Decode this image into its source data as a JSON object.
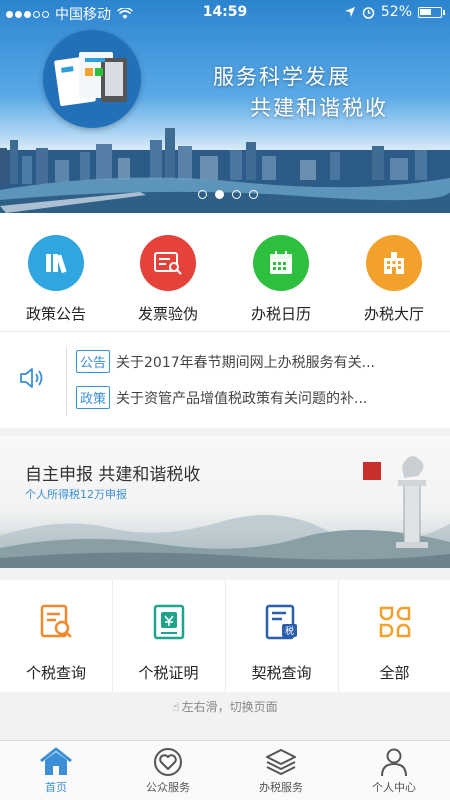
{
  "status_bar": {
    "carrier": "中国移动",
    "time": "14:59",
    "battery": "52%"
  },
  "banner": {
    "line1": "服务科学发展",
    "line2": "共建和谐税收",
    "active_page": 2,
    "page_count": 4
  },
  "quick_actions": [
    {
      "label": "政策公告",
      "icon": "policy-books-icon",
      "color": "#2fa6df"
    },
    {
      "label": "发票验伪",
      "icon": "invoice-search-icon",
      "color": "#e4423b"
    },
    {
      "label": "办税日历",
      "icon": "calendar-icon",
      "color": "#2fbf3f"
    },
    {
      "label": "办税大厅",
      "icon": "tax-hall-building-icon",
      "color": "#f2a12a"
    }
  ],
  "news": [
    {
      "tag": "公告",
      "text": "关于2017年春节期间网上办税服务有关..."
    },
    {
      "tag": "政策",
      "text": "关于资管产品增值税政策有关问题的补..."
    }
  ],
  "promo": {
    "title": "自主申报  共建和谐税收",
    "subtitle": "个人所得税12万申报"
  },
  "services": [
    {
      "label": "个税查询",
      "icon": "tax-query-icon",
      "color": "#f08a2c"
    },
    {
      "label": "个税证明",
      "icon": "tax-certificate-icon",
      "color": "#1fa38b"
    },
    {
      "label": "契税查询",
      "icon": "deed-tax-query-icon",
      "color": "#2b5fae"
    },
    {
      "label": "全部",
      "icon": "all-grid-icon",
      "color": "#f2a12a"
    }
  ],
  "hint": "左右滑，切换页面",
  "tabs": [
    {
      "label": "首页",
      "icon": "home-icon",
      "active": true
    },
    {
      "label": "公众服务",
      "icon": "heart-service-icon",
      "active": false
    },
    {
      "label": "办税服务",
      "icon": "layers-icon",
      "active": false
    },
    {
      "label": "个人中心",
      "icon": "person-icon",
      "active": false
    }
  ],
  "colors": {
    "accent": "#3b8fd7",
    "inactive": "#555555"
  }
}
